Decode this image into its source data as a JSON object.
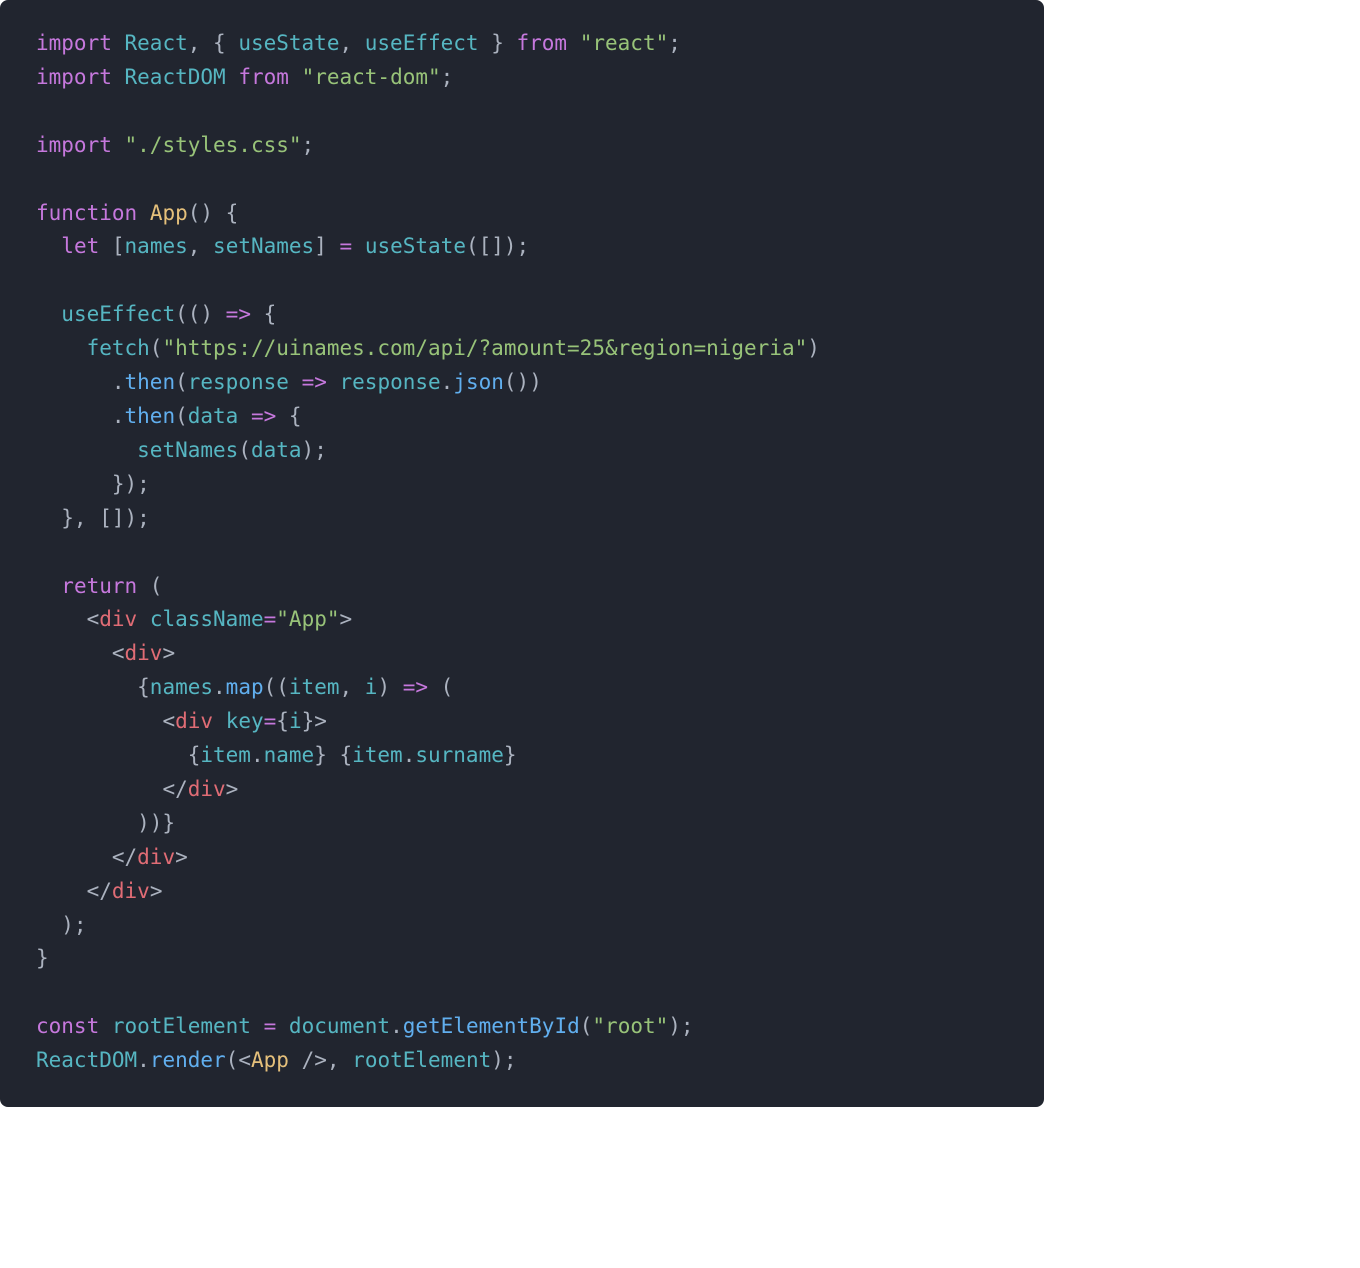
{
  "code": {
    "lines": [
      [
        {
          "c": "kw",
          "t": "import"
        },
        {
          "c": "punct",
          "t": " "
        },
        {
          "c": "name",
          "t": "React"
        },
        {
          "c": "punct",
          "t": ", { "
        },
        {
          "c": "name",
          "t": "useState"
        },
        {
          "c": "punct",
          "t": ", "
        },
        {
          "c": "name",
          "t": "useEffect"
        },
        {
          "c": "punct",
          "t": " } "
        },
        {
          "c": "kw",
          "t": "from"
        },
        {
          "c": "punct",
          "t": " "
        },
        {
          "c": "str",
          "t": "\"react\""
        },
        {
          "c": "punct",
          "t": ";"
        }
      ],
      [
        {
          "c": "kw",
          "t": "import"
        },
        {
          "c": "punct",
          "t": " "
        },
        {
          "c": "name",
          "t": "ReactDOM"
        },
        {
          "c": "punct",
          "t": " "
        },
        {
          "c": "kw",
          "t": "from"
        },
        {
          "c": "punct",
          "t": " "
        },
        {
          "c": "str",
          "t": "\"react-dom\""
        },
        {
          "c": "punct",
          "t": ";"
        }
      ],
      [
        {
          "c": "punct",
          "t": ""
        }
      ],
      [
        {
          "c": "kw",
          "t": "import"
        },
        {
          "c": "punct",
          "t": " "
        },
        {
          "c": "str",
          "t": "\"./styles.css\""
        },
        {
          "c": "punct",
          "t": ";"
        }
      ],
      [
        {
          "c": "punct",
          "t": ""
        }
      ],
      [
        {
          "c": "kw",
          "t": "function"
        },
        {
          "c": "punct",
          "t": " "
        },
        {
          "c": "fn-yel",
          "t": "App"
        },
        {
          "c": "punct",
          "t": "() {"
        }
      ],
      [
        {
          "c": "punct",
          "t": "  "
        },
        {
          "c": "kw",
          "t": "let"
        },
        {
          "c": "punct",
          "t": " ["
        },
        {
          "c": "var",
          "t": "names"
        },
        {
          "c": "punct",
          "t": ", "
        },
        {
          "c": "var",
          "t": "setNames"
        },
        {
          "c": "punct",
          "t": "] "
        },
        {
          "c": "op",
          "t": "="
        },
        {
          "c": "punct",
          "t": " "
        },
        {
          "c": "name",
          "t": "useState"
        },
        {
          "c": "punct",
          "t": "([]);"
        }
      ],
      [
        {
          "c": "punct",
          "t": ""
        }
      ],
      [
        {
          "c": "punct",
          "t": "  "
        },
        {
          "c": "name",
          "t": "useEffect"
        },
        {
          "c": "punct",
          "t": "(() "
        },
        {
          "c": "op",
          "t": "=>"
        },
        {
          "c": "punct",
          "t": " {"
        }
      ],
      [
        {
          "c": "punct",
          "t": "    "
        },
        {
          "c": "name",
          "t": "fetch"
        },
        {
          "c": "punct",
          "t": "("
        },
        {
          "c": "str",
          "t": "\"https://uinames.com/api/?amount=25&region=nigeria\""
        },
        {
          "c": "punct",
          "t": ")"
        }
      ],
      [
        {
          "c": "punct",
          "t": "      ."
        },
        {
          "c": "fn",
          "t": "then"
        },
        {
          "c": "punct",
          "t": "("
        },
        {
          "c": "var",
          "t": "response"
        },
        {
          "c": "punct",
          "t": " "
        },
        {
          "c": "op",
          "t": "=>"
        },
        {
          "c": "punct",
          "t": " "
        },
        {
          "c": "var",
          "t": "response"
        },
        {
          "c": "punct",
          "t": "."
        },
        {
          "c": "fn",
          "t": "json"
        },
        {
          "c": "punct",
          "t": "())"
        }
      ],
      [
        {
          "c": "punct",
          "t": "      ."
        },
        {
          "c": "fn",
          "t": "then"
        },
        {
          "c": "punct",
          "t": "("
        },
        {
          "c": "var",
          "t": "data"
        },
        {
          "c": "punct",
          "t": " "
        },
        {
          "c": "op",
          "t": "=>"
        },
        {
          "c": "punct",
          "t": " {"
        }
      ],
      [
        {
          "c": "punct",
          "t": "        "
        },
        {
          "c": "name",
          "t": "setNames"
        },
        {
          "c": "punct",
          "t": "("
        },
        {
          "c": "var",
          "t": "data"
        },
        {
          "c": "punct",
          "t": ");"
        }
      ],
      [
        {
          "c": "punct",
          "t": "      });"
        }
      ],
      [
        {
          "c": "punct",
          "t": "  }, []);"
        }
      ],
      [
        {
          "c": "punct",
          "t": ""
        }
      ],
      [
        {
          "c": "punct",
          "t": "  "
        },
        {
          "c": "kw",
          "t": "return"
        },
        {
          "c": "punct",
          "t": " ("
        }
      ],
      [
        {
          "c": "punct",
          "t": "    "
        },
        {
          "c": "tagp",
          "t": "<"
        },
        {
          "c": "tag",
          "t": "div"
        },
        {
          "c": "punct",
          "t": " "
        },
        {
          "c": "prop",
          "t": "className"
        },
        {
          "c": "op",
          "t": "="
        },
        {
          "c": "str",
          "t": "\"App\""
        },
        {
          "c": "tagp",
          "t": ">"
        }
      ],
      [
        {
          "c": "punct",
          "t": "      "
        },
        {
          "c": "tagp",
          "t": "<"
        },
        {
          "c": "tag",
          "t": "div"
        },
        {
          "c": "tagp",
          "t": ">"
        }
      ],
      [
        {
          "c": "punct",
          "t": "        {"
        },
        {
          "c": "var",
          "t": "names"
        },
        {
          "c": "punct",
          "t": "."
        },
        {
          "c": "fn",
          "t": "map"
        },
        {
          "c": "punct",
          "t": "(("
        },
        {
          "c": "var",
          "t": "item"
        },
        {
          "c": "punct",
          "t": ", "
        },
        {
          "c": "var",
          "t": "i"
        },
        {
          "c": "punct",
          "t": ") "
        },
        {
          "c": "op",
          "t": "=>"
        },
        {
          "c": "punct",
          "t": " ("
        }
      ],
      [
        {
          "c": "punct",
          "t": "          "
        },
        {
          "c": "tagp",
          "t": "<"
        },
        {
          "c": "tag",
          "t": "div"
        },
        {
          "c": "punct",
          "t": " "
        },
        {
          "c": "prop",
          "t": "key"
        },
        {
          "c": "op",
          "t": "="
        },
        {
          "c": "punct",
          "t": "{"
        },
        {
          "c": "var",
          "t": "i"
        },
        {
          "c": "punct",
          "t": "}"
        },
        {
          "c": "tagp",
          "t": ">"
        }
      ],
      [
        {
          "c": "punct",
          "t": "            {"
        },
        {
          "c": "var",
          "t": "item"
        },
        {
          "c": "punct",
          "t": "."
        },
        {
          "c": "attr",
          "t": "name"
        },
        {
          "c": "punct",
          "t": "} {"
        },
        {
          "c": "var",
          "t": "item"
        },
        {
          "c": "punct",
          "t": "."
        },
        {
          "c": "attr",
          "t": "surname"
        },
        {
          "c": "punct",
          "t": "}"
        }
      ],
      [
        {
          "c": "punct",
          "t": "          "
        },
        {
          "c": "tagp",
          "t": "</"
        },
        {
          "c": "tag",
          "t": "div"
        },
        {
          "c": "tagp",
          "t": ">"
        }
      ],
      [
        {
          "c": "punct",
          "t": "        ))}"
        }
      ],
      [
        {
          "c": "punct",
          "t": "      "
        },
        {
          "c": "tagp",
          "t": "</"
        },
        {
          "c": "tag",
          "t": "div"
        },
        {
          "c": "tagp",
          "t": ">"
        }
      ],
      [
        {
          "c": "punct",
          "t": "    "
        },
        {
          "c": "tagp",
          "t": "</"
        },
        {
          "c": "tag",
          "t": "div"
        },
        {
          "c": "tagp",
          "t": ">"
        }
      ],
      [
        {
          "c": "punct",
          "t": "  );"
        }
      ],
      [
        {
          "c": "punct",
          "t": "}"
        }
      ],
      [
        {
          "c": "punct",
          "t": ""
        }
      ],
      [
        {
          "c": "kw",
          "t": "const"
        },
        {
          "c": "punct",
          "t": " "
        },
        {
          "c": "var",
          "t": "rootElement"
        },
        {
          "c": "punct",
          "t": " "
        },
        {
          "c": "op",
          "t": "="
        },
        {
          "c": "punct",
          "t": " "
        },
        {
          "c": "var",
          "t": "document"
        },
        {
          "c": "punct",
          "t": "."
        },
        {
          "c": "fn",
          "t": "getElementById"
        },
        {
          "c": "punct",
          "t": "("
        },
        {
          "c": "str",
          "t": "\"root\""
        },
        {
          "c": "punct",
          "t": ");"
        }
      ],
      [
        {
          "c": "name",
          "t": "ReactDOM"
        },
        {
          "c": "punct",
          "t": "."
        },
        {
          "c": "fn",
          "t": "render"
        },
        {
          "c": "punct",
          "t": "("
        },
        {
          "c": "tagp",
          "t": "<"
        },
        {
          "c": "fn-yel",
          "t": "App"
        },
        {
          "c": "punct",
          "t": " "
        },
        {
          "c": "tagp",
          "t": "/>"
        },
        {
          "c": "punct",
          "t": ", "
        },
        {
          "c": "var",
          "t": "rootElement"
        },
        {
          "c": "punct",
          "t": ");"
        }
      ]
    ]
  }
}
